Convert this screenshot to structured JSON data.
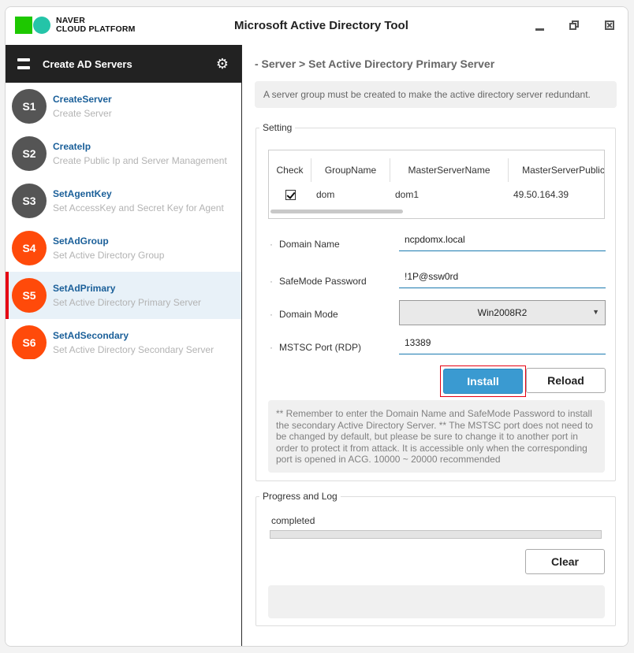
{
  "app": {
    "logo_line1": "NAVER",
    "logo_line2": "CLOUD PLATFORM",
    "title": "Microsoft Active Directory Tool"
  },
  "sidebar": {
    "title": "Create AD Servers",
    "steps": [
      {
        "badge": "S1",
        "name": "CreateServer",
        "desc": "Create Server"
      },
      {
        "badge": "S2",
        "name": "CreateIp",
        "desc": "Create Public Ip and Server Management"
      },
      {
        "badge": "S3",
        "name": "SetAgentKey",
        "desc": "Set AccessKey and Secret Key for Agent"
      },
      {
        "badge": "S4",
        "name": "SetAdGroup",
        "desc": "Set Active Directory Group"
      },
      {
        "badge": "S5",
        "name": "SetAdPrimary",
        "desc": "Set Active Directory Primary Server"
      },
      {
        "badge": "S6",
        "name": "SetAdSecondary",
        "desc": "Set Active Directory Secondary Server"
      }
    ]
  },
  "main": {
    "breadcrumb": "- Server > Set Active Directory Primary Server",
    "notice": "A server group must be created to make the active directory server redundant.",
    "setting": {
      "legend": "Setting",
      "grid": {
        "columns": [
          "Check",
          "GroupName",
          "MasterServerName",
          "MasterServerPublic"
        ],
        "rows": [
          {
            "checked": true,
            "group_name": "dom",
            "master_server_name": "dom1",
            "master_server_public": "49.50.164.39"
          }
        ]
      },
      "fields": {
        "domain_name_label": "Domain Name",
        "domain_name_value": "ncpdomx.local",
        "safemode_label": "SafeMode Password",
        "safemode_value": "!1P@ssw0rd",
        "domain_mode_label": "Domain Mode",
        "domain_mode_value": "Win2008R2",
        "mstsc_label": "MSTSC Port (RDP)",
        "mstsc_value": "13389"
      },
      "install_label": "Install",
      "reload_label": "Reload",
      "remember_text": "** Remember to enter the Domain Name and SafeMode Password to install the secondary Active Directory Server. ** The MSTSC port does not need to be changed by default, but please be sure to change it to another port in order to protect it from attack. It is accessible only when the corresponding port is opened in ACG. 10000 ~ 20000 recommended"
    },
    "progress": {
      "legend": "Progress and Log",
      "status": "completed",
      "clear_label": "Clear"
    }
  },
  "colors": {
    "accent_blue": "#3a9ad1",
    "step_orange": "#ff4a0a",
    "step_gray": "#555555",
    "active_marker": "#e60012",
    "link_blue": "#1a5f99"
  }
}
